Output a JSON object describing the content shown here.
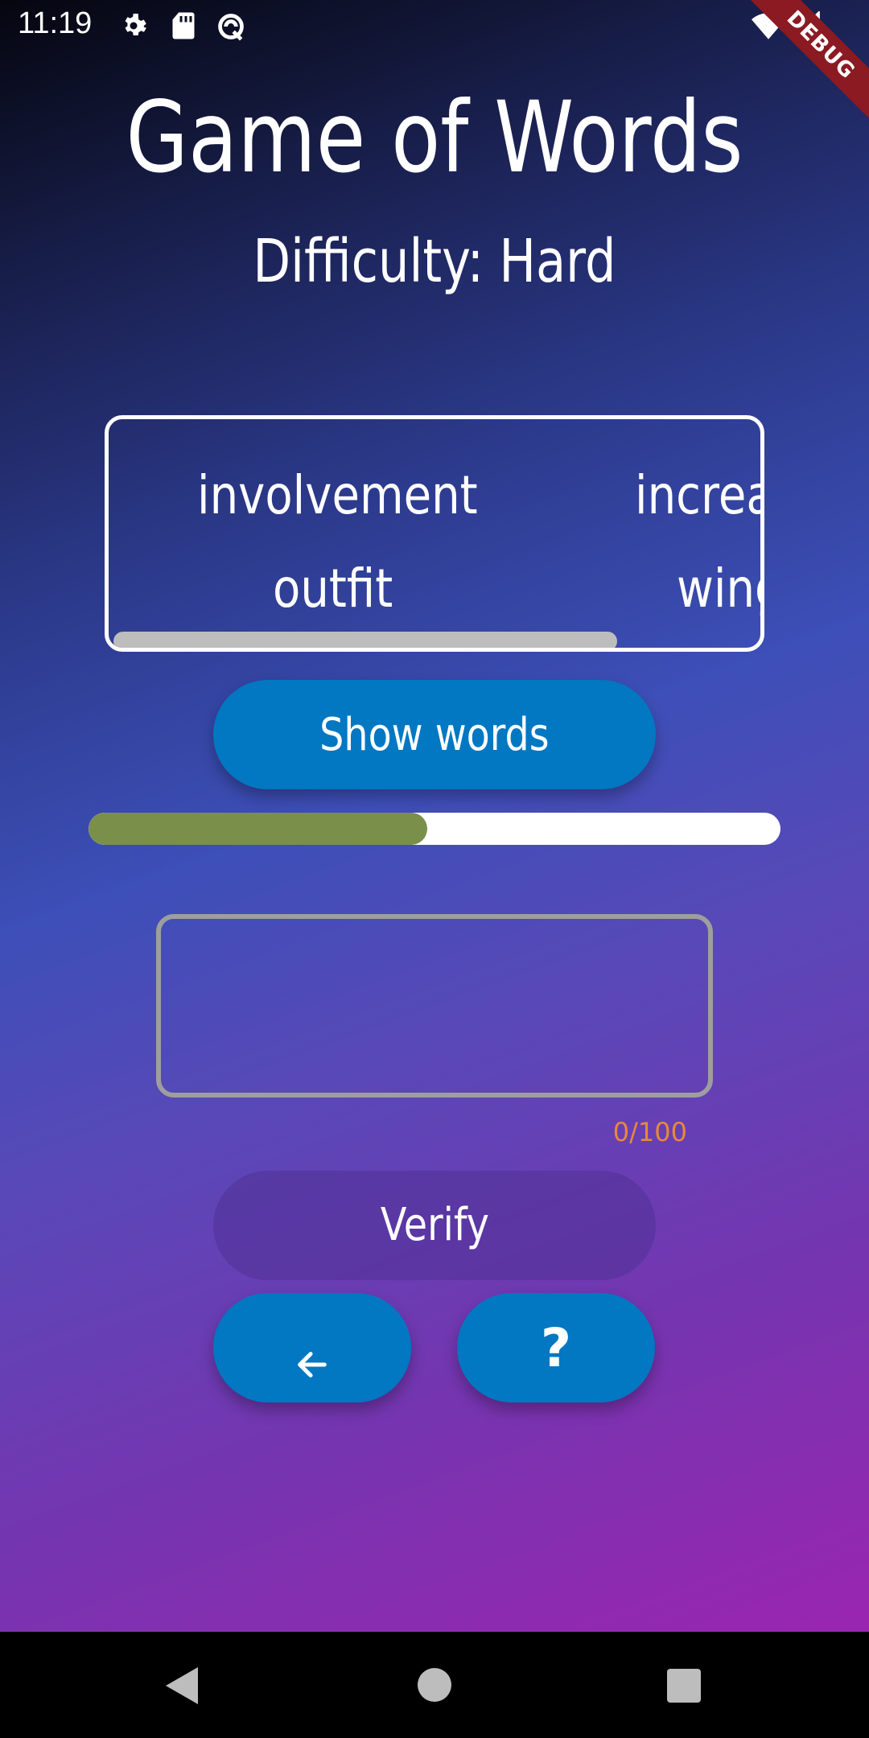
{
  "status_bar": {
    "time": "11:19",
    "icons": [
      "gear-icon",
      "sd-card-icon",
      "sync-icon",
      "wifi-icon",
      "signal-icon"
    ],
    "debug_label": "DEBUG"
  },
  "header": {
    "title": "Game of Words",
    "difficulty": "Difficulty: Hard"
  },
  "words_panel": {
    "words": [
      "involvement",
      "increa",
      "outfit",
      "wing"
    ]
  },
  "buttons": {
    "show_words": "Show words",
    "verify": "Verify",
    "back_icon": "arrow-left-icon",
    "help": "?"
  },
  "progress": {
    "fraction": 0.49,
    "fill_color": "#7a8f49",
    "track_color": "#ffffff"
  },
  "answer": {
    "value": "",
    "counter": "0/100"
  },
  "nav_bar": {
    "icons": [
      "back-triangle-icon",
      "home-circle-icon",
      "recents-square-icon"
    ]
  },
  "colors": {
    "button_blue": "#0277c2",
    "counter_orange": "#e8883a"
  }
}
